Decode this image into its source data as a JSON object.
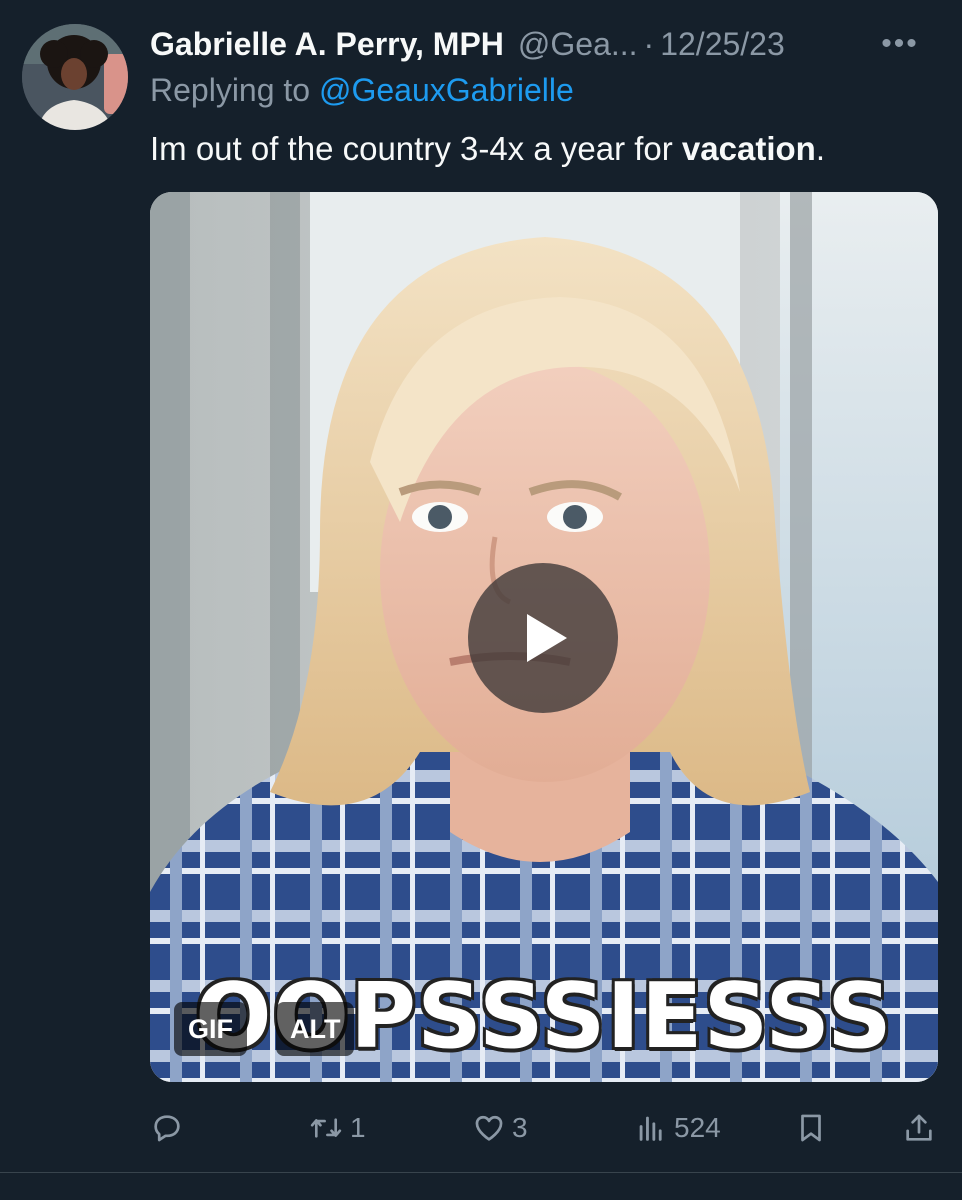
{
  "tweet": {
    "display_name": "Gabrielle A. Perry, MPH",
    "handle": "@Gea...",
    "separator": "·",
    "date": "12/25/23",
    "more_label": "•••",
    "replying_prefix": "Replying to",
    "replying_to": "@GeauxGabrielle",
    "text_before": "Im out of the country 3-4x a year for ",
    "text_bold": "vacation",
    "text_after": ".",
    "media": {
      "caption": "OOPSSSIESSS",
      "gif_badge": "GIF",
      "alt_badge": "ALT"
    },
    "actions": {
      "reply_count": "",
      "retweet_count": "1",
      "like_count": "3",
      "view_count": "524"
    }
  },
  "colors": {
    "background": "#15202b",
    "text_primary": "#f7f9f9",
    "text_secondary": "#8b98a5",
    "link": "#1d9bf0"
  },
  "icons": [
    "reply-icon",
    "retweet-icon",
    "like-icon",
    "views-icon",
    "bookmark-icon",
    "share-icon",
    "play-icon",
    "more-icon"
  ]
}
